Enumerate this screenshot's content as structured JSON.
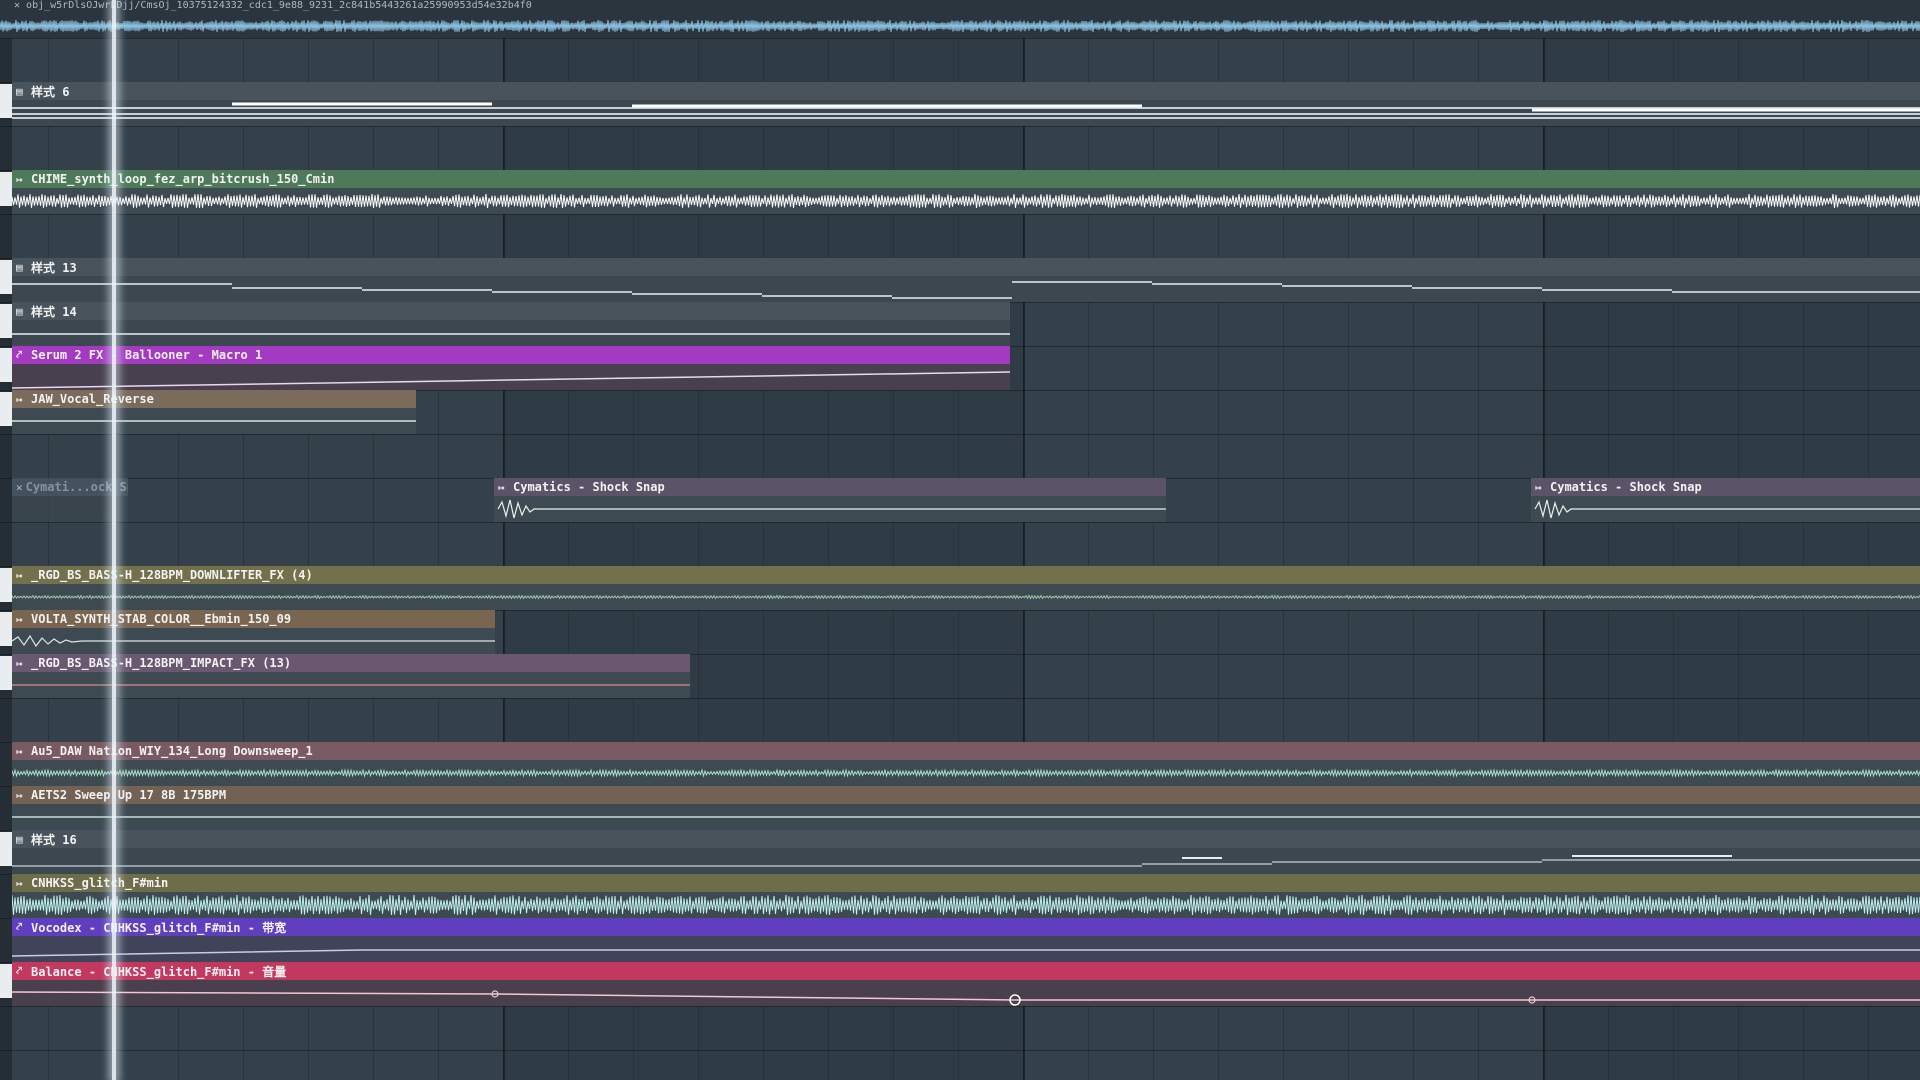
{
  "top_clip": {
    "label": "obj_w5rDlsOJwrLDjj/CmsOj_10375124332_cdc1_9e88_9231_2c841b5443261a25990953d54e32b4f0",
    "icon": "close-icon"
  },
  "clips": [
    {
      "id": "pattern-6",
      "label": "样式 6",
      "icon": "pattern-icon",
      "color": "#48535c"
    },
    {
      "id": "chime-loop",
      "label": "CHIME_synth_loop_fez_arp_bitcrush_150_Cmin",
      "icon": "audio-icon",
      "color": "#4e7a5a"
    },
    {
      "id": "pattern-13",
      "label": "样式 13",
      "icon": "pattern-icon",
      "color": "#48535c"
    },
    {
      "id": "pattern-14",
      "label": "样式 14",
      "icon": "pattern-icon",
      "color": "#48535c"
    },
    {
      "id": "serum-macro",
      "label": "Serum 2 FX - Ballooner - Macro 1",
      "icon": "automation-icon",
      "color": "#a43ac2"
    },
    {
      "id": "jaw-vocal",
      "label": "JAW_Vocal_Reverse",
      "icon": "audio-icon",
      "color": "#7b6b5a"
    },
    {
      "id": "cymatics-muted",
      "label": "Cymati...ock Snap",
      "icon": "close-icon",
      "color": "#4b5b6a"
    },
    {
      "id": "cymatics-1",
      "label": "Cymatics - Shock Snap",
      "icon": "audio-icon",
      "color": "#5b5468"
    },
    {
      "id": "cymatics-2",
      "label": "Cymatics - Shock Snap",
      "icon": "audio-icon",
      "color": "#5b5468"
    },
    {
      "id": "downlifter",
      "label": "_RGD_BS_BASS-H_128BPM_DOWNLIFTER_FX (4)",
      "icon": "audio-icon",
      "color": "#72714c"
    },
    {
      "id": "volta-stab",
      "label": "VOLTA_SYNTH_STAB_COLOR__Ebmin_150_09",
      "icon": "audio-icon",
      "color": "#7a6550"
    },
    {
      "id": "impact-fx",
      "label": "_RGD_BS_BASS-H_128BPM_IMPACT_FX (13)",
      "icon": "audio-icon",
      "color": "#6a5870"
    },
    {
      "id": "downsweep",
      "label": "Au5_DAW Nation_WIY_134_Long Downsweep_1",
      "icon": "audio-icon",
      "color": "#7a5a62"
    },
    {
      "id": "sweep-up",
      "label": "AETS2 Sweep Up 17 8B 175BPM",
      "icon": "audio-icon",
      "color": "#736254"
    },
    {
      "id": "pattern-16",
      "label": "样式 16",
      "icon": "pattern-icon",
      "color": "#48535c"
    },
    {
      "id": "glitch",
      "label": "CNHKSS_glitch_F#min",
      "icon": "audio-icon",
      "color": "#6e6d4a"
    },
    {
      "id": "vocodex",
      "label": "Vocodex - CNHKSS_glitch_F#min - 带宽",
      "icon": "automation-icon",
      "color": "#5f3fc0"
    },
    {
      "id": "balance",
      "label": "Balance - CNHKSS_glitch_F#min - 音量",
      "icon": "automation-icon",
      "color": "#c2385e"
    }
  ]
}
